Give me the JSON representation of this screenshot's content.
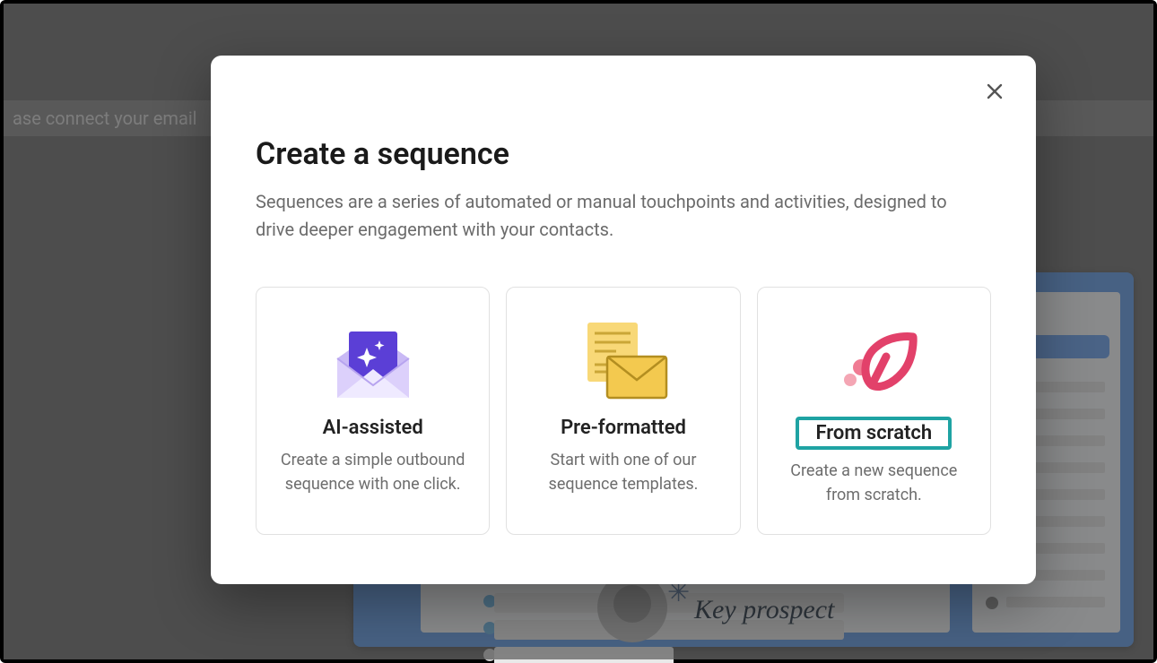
{
  "background": {
    "banner_text": "ase connect your email",
    "key_prospect_label": "Key prospect"
  },
  "modal": {
    "title": "Create a sequence",
    "subtitle": "Sequences are a series of automated or manual touchpoints and activities, designed to drive deeper engagement with your contacts.",
    "options": [
      {
        "title": "AI-assisted",
        "description": "Create a simple outbound sequence with one click.",
        "icon": "ai-envelope-icon"
      },
      {
        "title": "Pre-formatted",
        "description": "Start with one of our sequence templates.",
        "icon": "template-envelope-icon"
      },
      {
        "title": "From scratch",
        "description": "Create a new sequence from scratch.",
        "icon": "paper-plane-icon",
        "highlighted": true
      }
    ]
  }
}
